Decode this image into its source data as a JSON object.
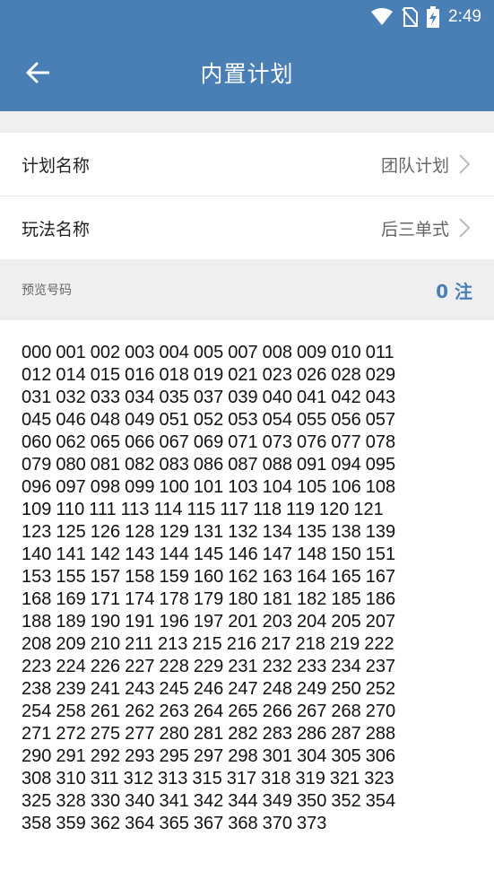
{
  "status_bar": {
    "time": "2:49",
    "icons": [
      "wifi-icon",
      "no-sim-icon",
      "battery-charging-icon"
    ]
  },
  "app_bar": {
    "title": "内置计划",
    "back_icon": "arrow-left-icon"
  },
  "form": {
    "plan_name_label": "计划名称",
    "plan_name_value": "团队计划",
    "play_name_label": "玩法名称",
    "play_name_value": "后三单式"
  },
  "preview": {
    "label": "预览号码",
    "count": "0 注"
  },
  "numbers": [
    "000",
    "001",
    "002",
    "003",
    "004",
    "005",
    "007",
    "008",
    "009",
    "010",
    "011",
    "012",
    "014",
    "015",
    "016",
    "018",
    "019",
    "021",
    "023",
    "026",
    "028",
    "029",
    "031",
    "032",
    "033",
    "034",
    "035",
    "037",
    "039",
    "040",
    "041",
    "042",
    "043",
    "045",
    "046",
    "048",
    "049",
    "051",
    "052",
    "053",
    "054",
    "055",
    "056",
    "057",
    "060",
    "062",
    "065",
    "066",
    "067",
    "069",
    "071",
    "073",
    "076",
    "077",
    "078",
    "079",
    "080",
    "081",
    "082",
    "083",
    "086",
    "087",
    "088",
    "091",
    "094",
    "095",
    "096",
    "097",
    "098",
    "099",
    "100",
    "101",
    "103",
    "104",
    "105",
    "106",
    "108",
    "109",
    "110",
    "111",
    "113",
    "114",
    "115",
    "117",
    "118",
    "119",
    "120",
    "121",
    "123",
    "125",
    "126",
    "128",
    "129",
    "131",
    "132",
    "134",
    "135",
    "138",
    "139",
    "140",
    "141",
    "142",
    "143",
    "144",
    "145",
    "146",
    "147",
    "148",
    "150",
    "151",
    "153",
    "155",
    "157",
    "158",
    "159",
    "160",
    "162",
    "163",
    "164",
    "165",
    "167",
    "168",
    "169",
    "171",
    "174",
    "178",
    "179",
    "180",
    "181",
    "182",
    "185",
    "186",
    "188",
    "189",
    "190",
    "191",
    "196",
    "197",
    "201",
    "203",
    "204",
    "205",
    "207",
    "208",
    "209",
    "210",
    "211",
    "213",
    "215",
    "216",
    "217",
    "218",
    "219",
    "222",
    "223",
    "224",
    "226",
    "227",
    "228",
    "229",
    "231",
    "232",
    "233",
    "234",
    "237",
    "238",
    "239",
    "241",
    "243",
    "245",
    "246",
    "247",
    "248",
    "249",
    "250",
    "252",
    "254",
    "258",
    "261",
    "262",
    "263",
    "264",
    "265",
    "266",
    "267",
    "268",
    "270",
    "271",
    "272",
    "275",
    "277",
    "280",
    "281",
    "282",
    "283",
    "286",
    "287",
    "288",
    "290",
    "291",
    "292",
    "293",
    "295",
    "297",
    "298",
    "301",
    "304",
    "305",
    "306",
    "308",
    "310",
    "311",
    "312",
    "313",
    "315",
    "317",
    "318",
    "319",
    "321",
    "323",
    "325",
    "328",
    "330",
    "340",
    "341",
    "342",
    "344",
    "349",
    "350",
    "352",
    "354",
    "358",
    "359",
    "362",
    "364",
    "365",
    "367",
    "368",
    "370",
    "373"
  ]
}
